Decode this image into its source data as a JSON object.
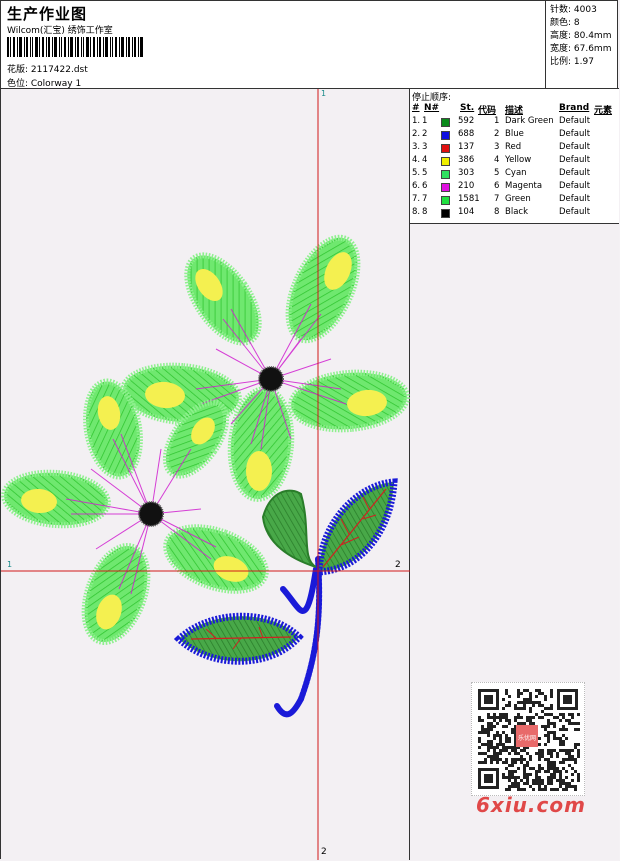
{
  "header": {
    "title": "生产作业图",
    "subtitle": "Wilcom(汇宝) 绣饰工作室",
    "pattern_label": "花版: 2117422.dst",
    "colorway_label": "色位: Colorway 1"
  },
  "stats": {
    "stitches": "针数: 4003",
    "colors": "颜色: 8",
    "height": "高度: 80.4mm",
    "width": "宽度: 67.6mm",
    "scale": "比例: 1.97"
  },
  "axis_labels": {
    "top": "1",
    "bottom": "2",
    "left": "1",
    "right": "2"
  },
  "table": {
    "title": "停止顺序:",
    "headers": [
      "#",
      "N#",
      "St.",
      "代码",
      "描述",
      "Brand",
      "元素"
    ],
    "rows": [
      {
        "num": "1.",
        "n": "1",
        "color": "#0a8a1a",
        "st": "592",
        "code": "1",
        "desc": "Dark Green",
        "brand": "Default"
      },
      {
        "num": "2.",
        "n": "2",
        "color": "#1010e0",
        "st": "688",
        "code": "2",
        "desc": "Blue",
        "brand": "Default"
      },
      {
        "num": "3.",
        "n": "3",
        "color": "#e01010",
        "st": "137",
        "code": "3",
        "desc": "Red",
        "brand": "Default"
      },
      {
        "num": "4.",
        "n": "4",
        "color": "#f0f000",
        "st": "386",
        "code": "4",
        "desc": "Yellow",
        "brand": "Default"
      },
      {
        "num": "5.",
        "n": "5",
        "color": "#30e060",
        "st": "303",
        "code": "5",
        "desc": "Cyan",
        "brand": "Default"
      },
      {
        "num": "6.",
        "n": "6",
        "color": "#e010e0",
        "st": "210",
        "code": "6",
        "desc": "Magenta",
        "brand": "Default"
      },
      {
        "num": "7.",
        "n": "7",
        "color": "#20e040",
        "st": "1581",
        "code": "7",
        "desc": "Green",
        "brand": "Default"
      },
      {
        "num": "8.",
        "n": "8",
        "color": "#000000",
        "st": "104",
        "code": "8",
        "desc": "Black",
        "brand": "Default"
      }
    ]
  },
  "watermark": {
    "qr_center_text": "乐优网",
    "logo_text": "6xiu.com"
  }
}
